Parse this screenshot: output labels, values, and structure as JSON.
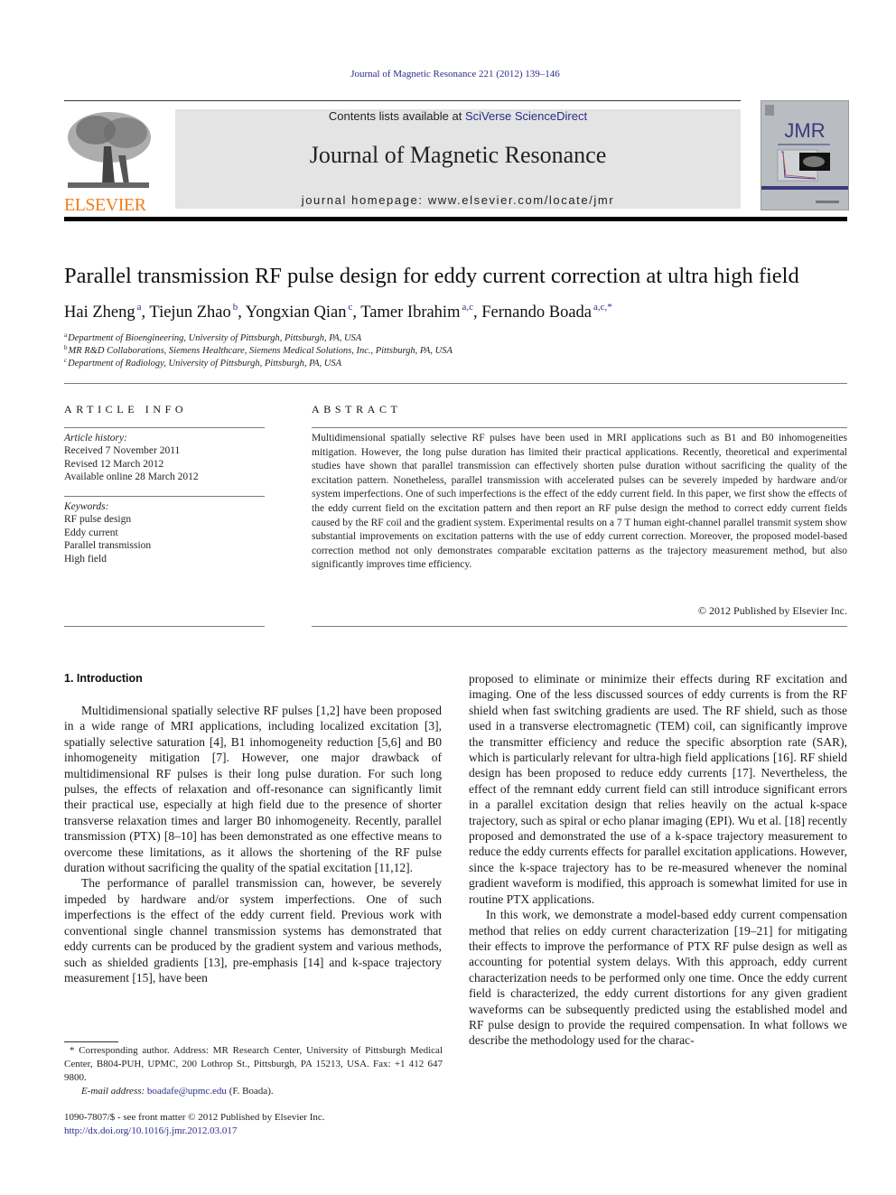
{
  "header": {
    "running_head": "Journal of Magnetic Resonance 221 (2012) 139–146",
    "publisher_logo_text": "ELSEVIER",
    "contents_prefix": "Contents lists available at ",
    "contents_link": "SciVerse ScienceDirect",
    "journal_title": "Journal of Magnetic Resonance",
    "homepage_label": "journal homepage: ",
    "homepage_url": "www.elsevier.com/locate/jmr",
    "cover_label": "JMR"
  },
  "colors": {
    "link": "#2b2b8a",
    "elsevier_orange": "#f07d1a",
    "banner_bg": "#e4e4e4"
  },
  "article": {
    "title": "Parallel transmission RF pulse design for eddy current correction at ultra high field",
    "authors": [
      {
        "name": "Hai Zheng",
        "affil": "a"
      },
      {
        "name": "Tiejun Zhao",
        "affil": "b"
      },
      {
        "name": "Yongxian Qian",
        "affil": "c"
      },
      {
        "name": "Tamer Ibrahim",
        "affil": "a,c"
      },
      {
        "name": "Fernando Boada",
        "affil": "a,c,*"
      }
    ],
    "affiliations": [
      {
        "key": "a",
        "text": "Department of Bioengineering, University of Pittsburgh, Pittsburgh, PA, USA"
      },
      {
        "key": "b",
        "text": "MR R&D Collaborations, Siemens Healthcare, Siemens Medical Solutions, Inc., Pittsburgh, PA, USA"
      },
      {
        "key": "c",
        "text": "Department of Radiology, University of Pittsburgh, Pittsburgh, PA, USA"
      }
    ]
  },
  "article_info": {
    "heading": "ARTICLE INFO",
    "history_label": "Article history:",
    "history": [
      "Received 7 November 2011",
      "Revised 12 March 2012",
      "Available online 28 March 2012"
    ],
    "keywords_label": "Keywords:",
    "keywords": [
      "RF pulse design",
      "Eddy current",
      "Parallel transmission",
      "High field"
    ]
  },
  "abstract": {
    "heading": "ABSTRACT",
    "text": "Multidimensional spatially selective RF pulses have been used in MRI applications such as B1 and B0 inhomogeneities mitigation. However, the long pulse duration has limited their practical applications. Recently, theoretical and experimental studies have shown that parallel transmission can effectively shorten pulse duration without sacrificing the quality of the excitation pattern. Nonetheless, parallel transmission with accelerated pulses can be severely impeded by hardware and/or system imperfections. One of such imperfections is the effect of the eddy current field. In this paper, we first show the effects of the eddy current field on the excitation pattern and then report an RF pulse design the method to correct eddy current fields caused by the RF coil and the gradient system. Experimental results on a 7 T human eight-channel parallel transmit system show substantial improvements on excitation patterns with the use of eddy current correction. Moreover, the proposed model-based correction method not only demonstrates comparable excitation patterns as the trajectory measurement method, but also significantly improves time efficiency.",
    "copyright": "© 2012 Published by Elsevier Inc."
  },
  "body": {
    "section_heading": "1. Introduction",
    "left_paragraphs": [
      "Multidimensional spatially selective RF pulses [1,2] have been proposed in a wide range of MRI applications, including localized excitation [3], spatially selective saturation [4], B1 inhomogeneity reduction [5,6] and B0 inhomogeneity mitigation [7]. However, one major drawback of multidimensional RF pulses is their long pulse duration. For such long pulses, the effects of relaxation and off-resonance can significantly limit their practical use, especially at high field due to the presence of shorter transverse relaxation times and larger B0 inhomogeneity. Recently, parallel transmission (PTX) [8–10] has been demonstrated as one effective means to overcome these limitations, as it allows the shortening of the RF pulse duration without sacrificing the quality of the spatial excitation [11,12].",
      "The performance of parallel transmission can, however, be severely impeded by hardware and/or system imperfections. One of such imperfections is the effect of the eddy current field. Previous work with conventional single channel transmission systems has demonstrated that eddy currents can be produced by the gradient system and various methods, such as shielded gradients [13], pre-emphasis [14] and k-space trajectory measurement [15], have been"
    ],
    "right_paragraphs": [
      "proposed to eliminate or minimize their effects during RF excitation and imaging. One of the less discussed sources of eddy currents is from the RF shield when fast switching gradients are used. The RF shield, such as those used in a transverse electromagnetic (TEM) coil, can significantly improve the transmitter efficiency and reduce the specific absorption rate (SAR), which is particularly relevant for ultra-high field applications [16]. RF shield design has been proposed to reduce eddy currents [17]. Nevertheless, the effect of the remnant eddy current field can still introduce significant errors in a parallel excitation design that relies heavily on the actual k-space trajectory, such as spiral or echo planar imaging (EPI). Wu et al. [18] recently proposed and demonstrated the use of a k-space trajectory measurement to reduce the eddy currents effects for parallel excitation applications. However, since the k-space trajectory has to be re-measured whenever the nominal gradient waveform is modified, this approach is somewhat limited for use in routine PTX applications.",
      "In this work, we demonstrate a model-based eddy current compensation method that relies on eddy current characterization [19–21] for mitigating their effects to improve the performance of PTX RF pulse design as well as accounting for potential system delays. With this approach, eddy current characterization needs to be performed only one time. Once the eddy current field is characterized, the eddy current distortions for any given gradient waveforms can be subsequently predicted using the established model and RF pulse design to provide the required compensation. In what follows we describe the methodology used for the charac-"
    ]
  },
  "footnotes": {
    "corresponding": "* Corresponding author. Address: MR Research Center, University of Pittsburgh Medical Center, B804-PUH, UPMC, 200 Lothrop St., Pittsburgh, PA 15213, USA. Fax: +1 412 647 9800.",
    "email_label": "E-mail address: ",
    "email": "boadafe@upmc.edu",
    "email_suffix": " (F. Boada).",
    "issn": "1090-7807/$ - see front matter © 2012 Published by Elsevier Inc.",
    "doi": "http://dx.doi.org/10.1016/j.jmr.2012.03.017"
  }
}
